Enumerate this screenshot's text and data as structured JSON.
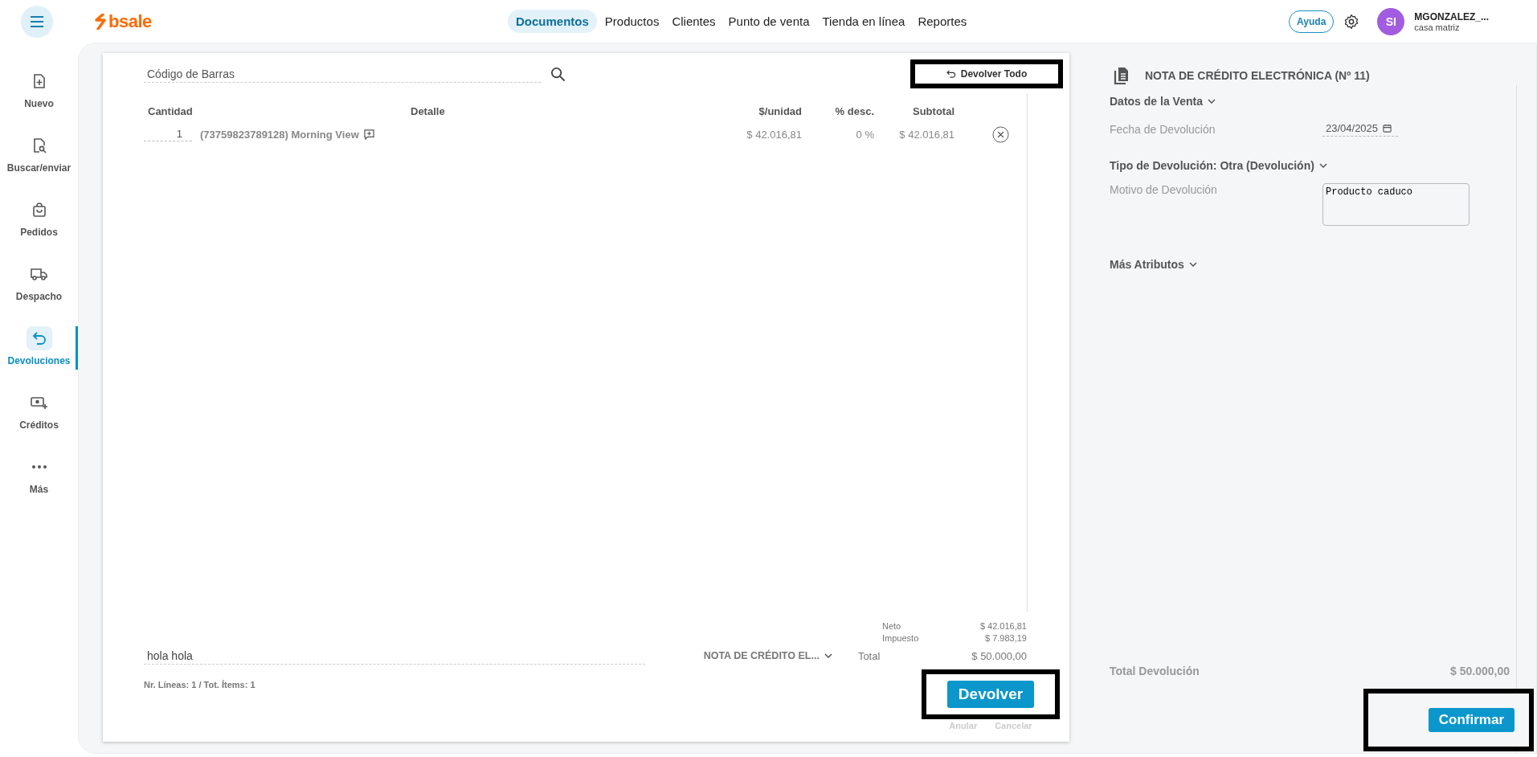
{
  "topbar": {
    "logo": "bsale",
    "nav": [
      {
        "label": "Documentos",
        "selected": true
      },
      {
        "label": "Productos",
        "selected": false
      },
      {
        "label": "Clientes",
        "selected": false
      },
      {
        "label": "Punto de venta",
        "selected": false
      },
      {
        "label": "Tienda en línea",
        "selected": false
      },
      {
        "label": "Reportes",
        "selected": false
      }
    ],
    "help": "Ayuda",
    "user": {
      "initials": "SI",
      "name": "MGONZALEZ_...",
      "branch": "casa matriz"
    }
  },
  "sidebar": {
    "items": [
      {
        "label": "Nuevo",
        "selected": false
      },
      {
        "label": "Buscar/enviar",
        "selected": false
      },
      {
        "label": "Pedidos",
        "selected": false
      },
      {
        "label": "Despacho",
        "selected": false
      },
      {
        "label": "Devoluciones",
        "selected": true
      },
      {
        "label": "Créditos",
        "selected": false
      },
      {
        "label": "Más",
        "selected": false
      }
    ]
  },
  "document": {
    "barcode": {
      "placeholder": "Código de Barras"
    },
    "return_all_button": {
      "label": "Devolver Todo",
      "highlighted": true
    },
    "columns": [
      "Cantidad",
      "Detalle",
      "$/unidad",
      "% desc.",
      "Subtotal"
    ],
    "rows": [
      {
        "quantity": "1",
        "detail": "(73759823789128) Morning View",
        "unit_price": "$ 42.016,81",
        "discount": "0 %",
        "subtotal": "$ 42.016,81"
      }
    ],
    "totals": [
      {
        "label": "Neto",
        "value": "$ 42.016,81"
      },
      {
        "label": "Impuesto",
        "value": "$ 7.983,19"
      }
    ],
    "comment": {
      "value": "hola hola"
    },
    "document_type": "NOTA DE CRÉDITO EL...",
    "total": {
      "label": "Total",
      "value": "$ 50.000,00"
    },
    "summary": "Nr. Líneas: 1 / Tot. Ítems: 1",
    "submit_button": {
      "label": "Devolver",
      "highlighted": true
    },
    "links": [
      "Anular",
      "Cancelar"
    ]
  },
  "panel": {
    "title": "NOTA DE CRÉDITO ELECTRÓNICA (Nº 11)",
    "sale_data": "Datos de la Venta",
    "date": {
      "label": "Fecha de Devolución",
      "value": "23/04/2025"
    },
    "return_type": "Tipo de Devolución: Otra (Devolución)",
    "reason": {
      "label": "Motivo de Devolución",
      "value": "Producto caduco"
    },
    "more": "Más Atributos",
    "total": {
      "label": "Total Devolución",
      "value": "$ 50.000,00"
    },
    "confirm_button": {
      "label": "Confirmar",
      "highlighted": true
    }
  }
}
